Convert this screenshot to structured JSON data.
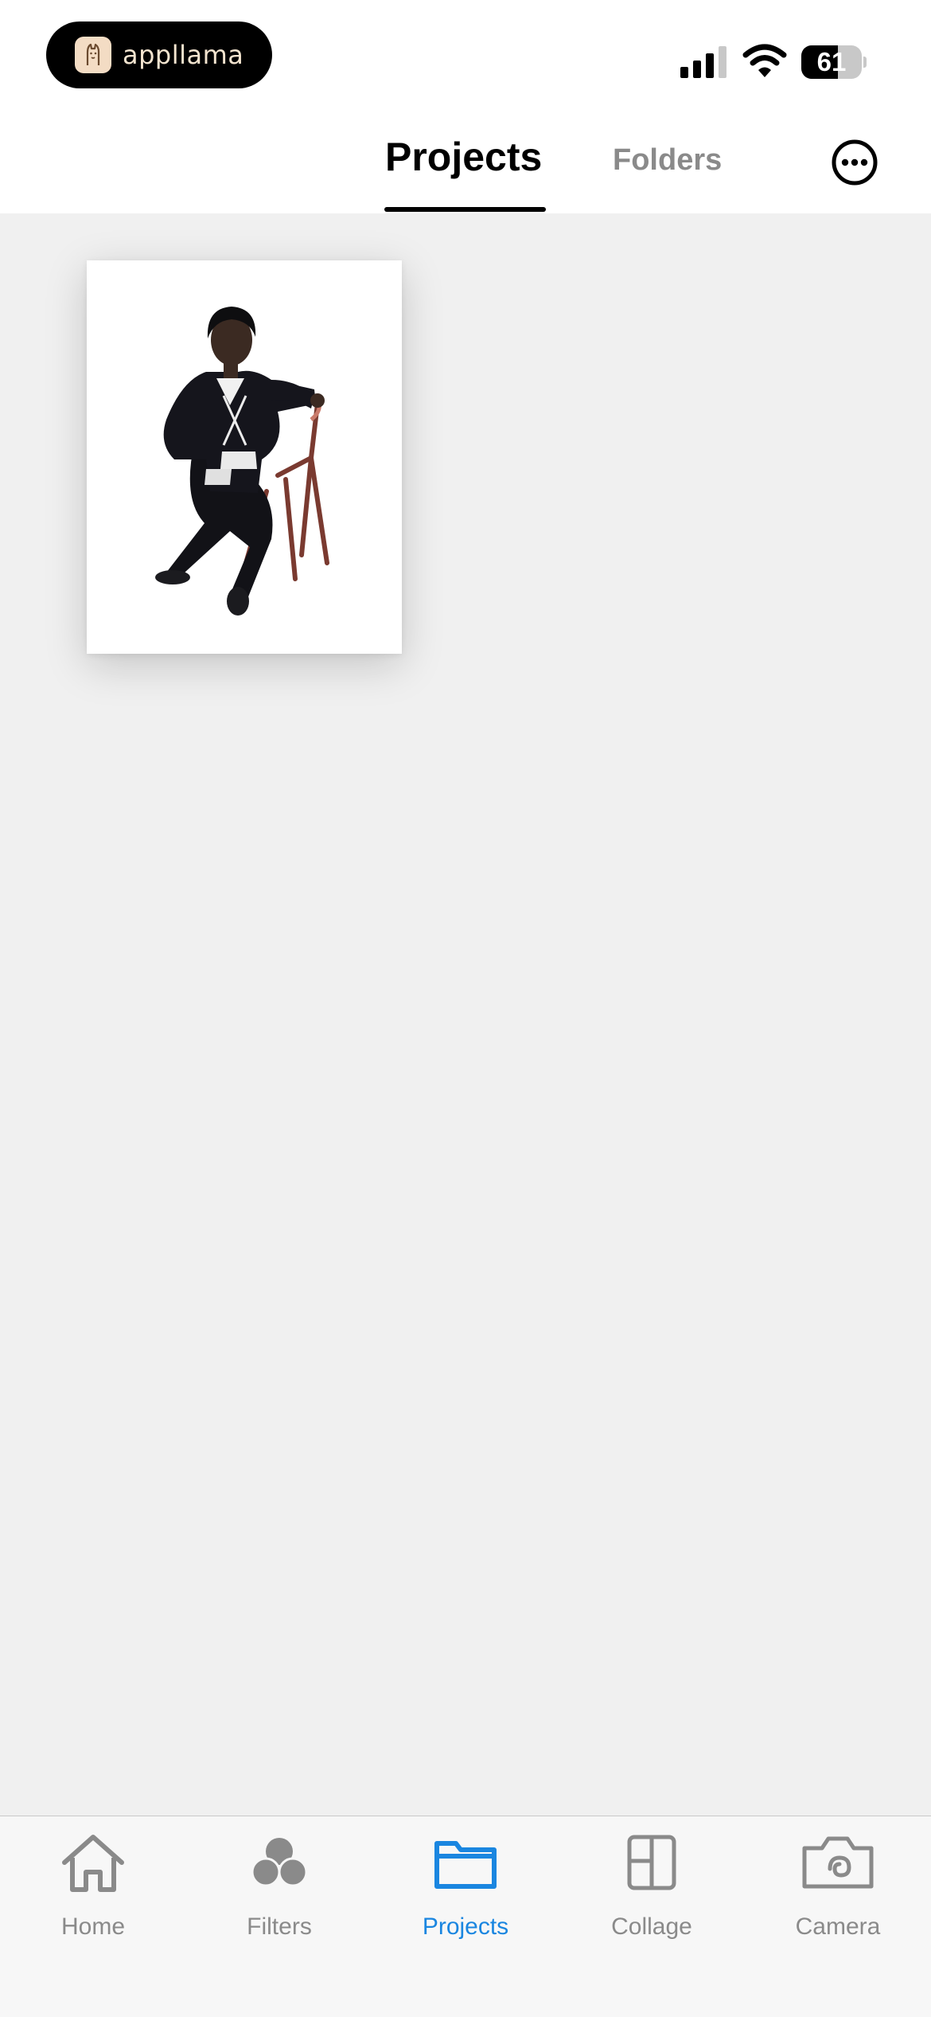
{
  "status_bar": {
    "app_name": "appllama",
    "battery_level": "61",
    "battery_fraction": 0.61,
    "signal_bars_active": 3,
    "icons": [
      "llama-logo-icon",
      "cellular-signal-icon",
      "wifi-icon",
      "battery-icon"
    ]
  },
  "header": {
    "tabs": [
      {
        "label": "Projects",
        "active": true
      },
      {
        "label": "Folders",
        "active": false
      }
    ],
    "more_icon": "ellipsis-circle-icon"
  },
  "projects": [
    {
      "thumbnail": "person-seated-on-chair-cutout"
    }
  ],
  "tabbar": {
    "items": [
      {
        "label": "Home",
        "icon": "house-icon",
        "active": false
      },
      {
        "label": "Filters",
        "icon": "filters-circles-icon",
        "active": false
      },
      {
        "label": "Projects",
        "icon": "folder-icon",
        "active": true
      },
      {
        "label": "Collage",
        "icon": "collage-grid-icon",
        "active": false
      },
      {
        "label": "Camera",
        "icon": "camera-icon",
        "active": false
      }
    ]
  },
  "colors": {
    "accent": "#1a86e0",
    "inactive": "#8a8a8a",
    "background": "#f0f0f0"
  }
}
